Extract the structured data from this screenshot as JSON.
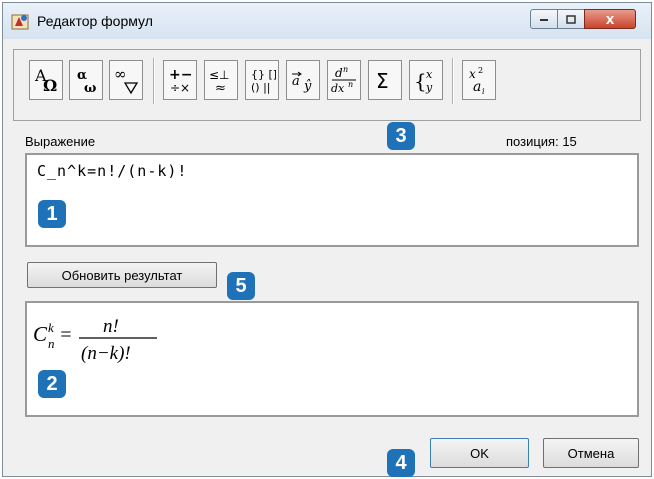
{
  "window": {
    "title": "Редактор формул",
    "close_symbol": "x"
  },
  "toolbar": {
    "buttons": [
      {
        "name": "greek-upper",
        "label": "AΩ"
      },
      {
        "name": "greek-lower",
        "label": "αω"
      },
      {
        "name": "symbols",
        "label": "∞▽"
      },
      {
        "name": "operators",
        "label": "+− ÷×"
      },
      {
        "name": "relations",
        "label": "≤⊥ ≈"
      },
      {
        "name": "brackets",
        "label": "{} [] () ||"
      },
      {
        "name": "vectors-accents",
        "label": "a ŷ"
      },
      {
        "name": "derivatives",
        "label": "dⁿ/dxⁿ"
      },
      {
        "name": "sum",
        "label": "Σ"
      },
      {
        "name": "matrices",
        "label": "{x y}"
      },
      {
        "name": "indices",
        "label": "x² aᵢ"
      }
    ]
  },
  "expression": {
    "label": "Выражение",
    "position_label": "позиция: 15",
    "value": "C_n^k=n!/(n-k)!"
  },
  "refresh_button": "Обновить результат",
  "result": {
    "base": "C",
    "sup": "k",
    "sub": "n",
    "eq": "=",
    "numerator": "n!",
    "denominator": "(n−k)!"
  },
  "ok_button": "OK",
  "cancel_button": "Отмена",
  "badges": [
    "1",
    "2",
    "3",
    "4",
    "5"
  ],
  "colors": {
    "badge": "#1f72b8",
    "close": "#c8452c"
  }
}
